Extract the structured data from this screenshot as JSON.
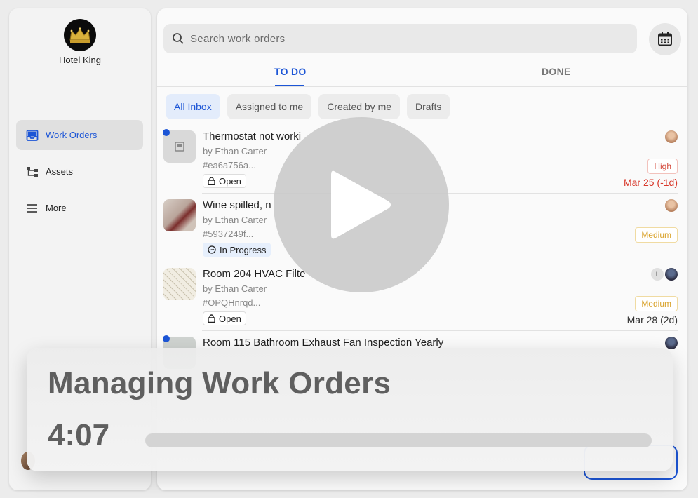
{
  "sidebar": {
    "hotel_name": "Hotel King",
    "nav": [
      {
        "label": "Work Orders",
        "icon": "inbox-icon",
        "active": true
      },
      {
        "label": "Assets",
        "icon": "hierarchy-icon",
        "active": false
      },
      {
        "label": "More",
        "icon": "menu-icon",
        "active": false
      }
    ]
  },
  "search": {
    "placeholder": "Search work orders"
  },
  "tabs": {
    "todo": "TO DO",
    "done": "DONE"
  },
  "filters": [
    "All Inbox",
    "Assigned to me",
    "Created by me",
    "Drafts"
  ],
  "work_orders": [
    {
      "title": "Thermostat not worki",
      "by": "by Ethan Carter",
      "code": "#ea6a756a...",
      "status": "Open",
      "priority": "High",
      "due": "Mar 25 (-1d)"
    },
    {
      "title": "Wine spilled, n",
      "by": "by Ethan Carter",
      "code": "#5937249f...",
      "status": "In Progress",
      "priority": "Medium",
      "due": ""
    },
    {
      "title": "Room 204 HVAC Filte",
      "by": "by Ethan Carter",
      "code": "#OPQHnrqd...",
      "status": "Open",
      "priority": "Medium",
      "due": "Mar 28 (2d)",
      "assignee_initial": "L"
    },
    {
      "title": "Room 115 Bathroom Exhaust Fan Inspection Yearly"
    }
  ],
  "video": {
    "title": "Managing Work Orders",
    "duration": "4:07",
    "progress": 0
  },
  "colors": {
    "accent": "#1c55d6",
    "high": "#d44a3c",
    "medium": "#d9a22a",
    "overdue": "#d8392c"
  }
}
